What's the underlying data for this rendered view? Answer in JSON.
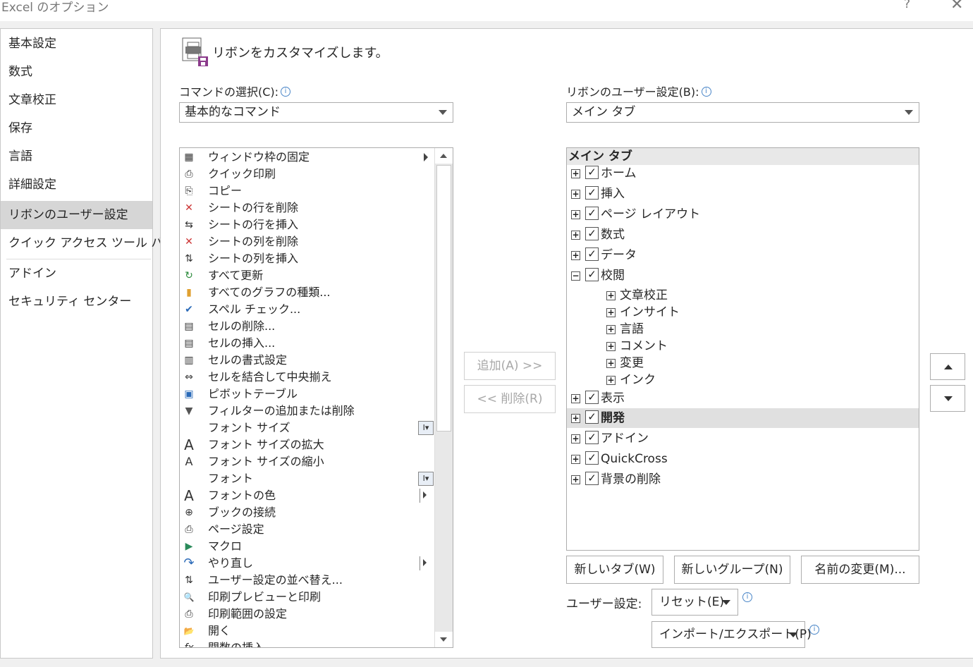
{
  "window": {
    "title": "Excel のオプション",
    "help": "?",
    "close": "✕"
  },
  "nav": {
    "items": [
      "基本設定",
      "数式",
      "文章校正",
      "保存",
      "言語",
      "詳細設定",
      "リボンのユーザー設定",
      "クイック アクセス ツール バー",
      "アドイン",
      "セキュリティ センター"
    ],
    "active": "リボンのユーザー設定"
  },
  "header": {
    "title": "リボンをカスタマイズします。"
  },
  "commands": {
    "label": "コマンドの選択(C):",
    "info": "i",
    "select_value": "基本的なコマンド",
    "items": [
      {
        "icon": "freeze-panes-icon",
        "glyph": "▦",
        "label": "ウィンドウ枠の固定"
      },
      {
        "icon": "quick-print-icon",
        "glyph": "⎙",
        "label": "クイック印刷"
      },
      {
        "icon": "copy-icon",
        "glyph": "⎘",
        "label": "コピー"
      },
      {
        "icon": "delete-row-icon",
        "glyph": "✕",
        "label": "シートの行を削除"
      },
      {
        "icon": "insert-row-icon",
        "glyph": "⇆",
        "label": "シートの行を挿入"
      },
      {
        "icon": "delete-column-icon",
        "glyph": "✕",
        "label": "シートの列を削除"
      },
      {
        "icon": "insert-column-icon",
        "glyph": "⇅",
        "label": "シートの列を挿入"
      },
      {
        "icon": "refresh-all-icon",
        "glyph": "↻",
        "label": "すべて更新"
      },
      {
        "icon": "all-charts-icon",
        "glyph": "▮",
        "label": "すべてのグラフの種類..."
      },
      {
        "icon": "spell-check-icon",
        "glyph": "✔",
        "label": "スペル チェック..."
      },
      {
        "icon": "delete-cells-icon",
        "glyph": "▤",
        "label": "セルの削除..."
      },
      {
        "icon": "insert-cells-icon",
        "glyph": "▤",
        "label": "セルの挿入..."
      },
      {
        "icon": "format-cells-icon",
        "glyph": "▥",
        "label": "セルの書式設定"
      },
      {
        "icon": "merge-center-icon",
        "glyph": "⇔",
        "label": "セルを結合して中央揃え"
      },
      {
        "icon": "pivot-table-icon",
        "glyph": "▣",
        "label": "ピボットテーブル"
      },
      {
        "icon": "filter-icon",
        "glyph": "▼",
        "label": "フィルターの追加または削除"
      },
      {
        "icon": "font-size-icon",
        "glyph": "",
        "label": "フォント サイズ"
      },
      {
        "icon": "increase-font-icon",
        "glyph": "A",
        "label": "フォント サイズの拡大"
      },
      {
        "icon": "decrease-font-icon",
        "glyph": "A",
        "label": "フォント サイズの縮小"
      },
      {
        "icon": "font-icon",
        "glyph": "",
        "label": "フォント"
      },
      {
        "icon": "font-color-icon",
        "glyph": "A",
        "label": "フォントの色"
      },
      {
        "icon": "connections-icon",
        "glyph": "⊕",
        "label": "ブックの接続"
      },
      {
        "icon": "page-setup-icon",
        "glyph": "⎙",
        "label": "ページ設定"
      },
      {
        "icon": "macro-icon",
        "glyph": "▶",
        "label": "マクロ"
      },
      {
        "icon": "redo-icon",
        "glyph": "↷",
        "label": "やり直し"
      },
      {
        "icon": "custom-sort-icon",
        "glyph": "⇅",
        "label": "ユーザー設定の並べ替え..."
      },
      {
        "icon": "print-preview-icon",
        "glyph": "🔍",
        "label": "印刷プレビューと印刷"
      },
      {
        "icon": "print-area-icon",
        "glyph": "⎙",
        "label": "印刷範囲の設定"
      },
      {
        "icon": "open-icon",
        "glyph": "📂",
        "label": "開く"
      },
      {
        "icon": "insert-function-icon",
        "glyph": "fx",
        "label": "関数の挿入..."
      }
    ],
    "dd_glyph": "I▾"
  },
  "actions": {
    "add": "追加(A) >>",
    "remove": "<< 削除(R)"
  },
  "ribbon": {
    "label": "リボンのユーザー設定(B):",
    "info": "i",
    "select_value": "メイン タブ",
    "tree_header": "メイン タブ",
    "tabs_a": [
      {
        "label": "ホーム",
        "expander": "+"
      },
      {
        "label": "挿入",
        "expander": "+"
      },
      {
        "label": "ページ レイアウト",
        "expander": "+"
      },
      {
        "label": "数式",
        "expander": "+"
      },
      {
        "label": "データ",
        "expander": "+"
      },
      {
        "label": "校閲",
        "expander": "−"
      }
    ],
    "groups": [
      {
        "label": "文章校正"
      },
      {
        "label": "インサイト"
      },
      {
        "label": "言語"
      },
      {
        "label": "コメント"
      },
      {
        "label": "変更"
      },
      {
        "label": "インク"
      }
    ],
    "tabs_b": [
      {
        "label": "表示"
      },
      {
        "label": "開発"
      },
      {
        "label": "アドイン"
      },
      {
        "label": "QuickCross"
      },
      {
        "label": "背景の削除"
      }
    ],
    "check": "✓",
    "plus": "+"
  },
  "buttons": {
    "new_tab": "新しいタブ(W)",
    "new_group": "新しいグループ(N)",
    "rename": "名前の変更(M)..."
  },
  "customizations": {
    "label": "ユーザー設定:",
    "reset": "リセット(E)",
    "import_export": "インポート/エクスポート(P)",
    "info": "i"
  }
}
